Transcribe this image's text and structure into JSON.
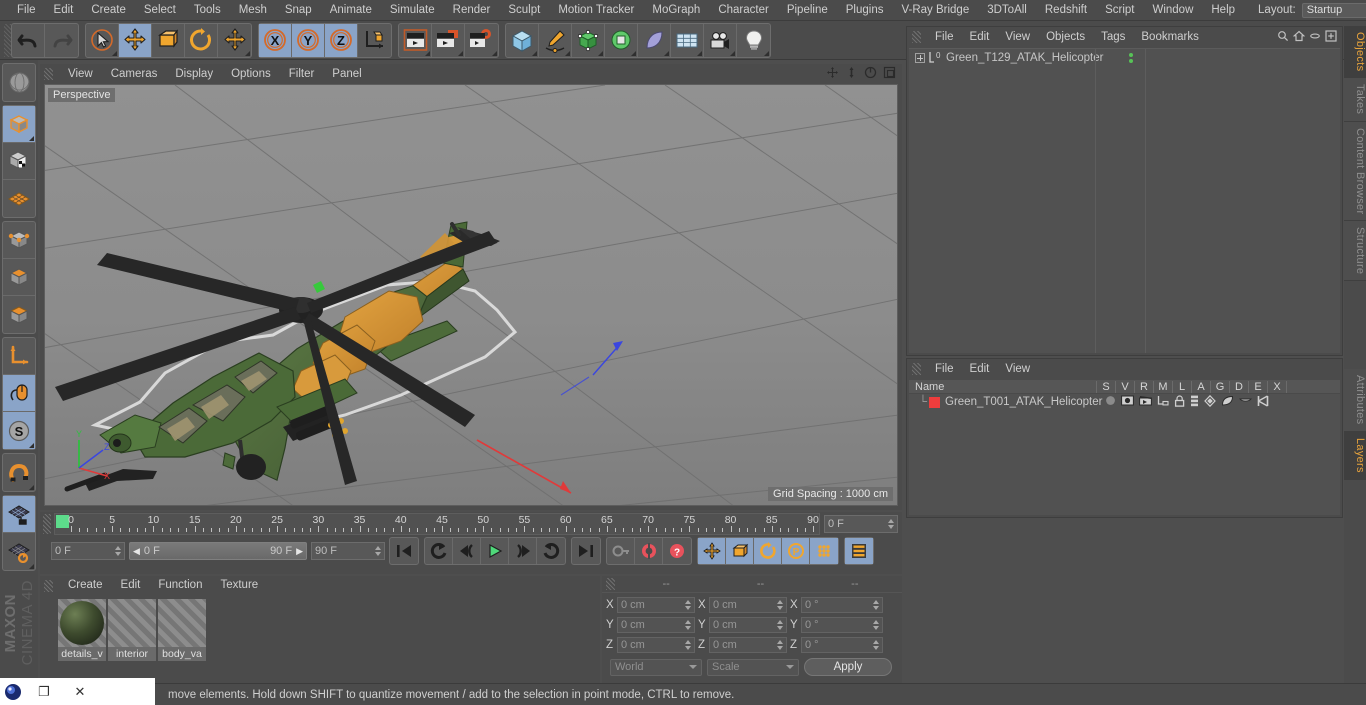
{
  "menubar": {
    "items": [
      "File",
      "Edit",
      "Create",
      "Select",
      "Tools",
      "Mesh",
      "Snap",
      "Animate",
      "Simulate",
      "Render",
      "Sculpt",
      "Motion Tracker",
      "MoGraph",
      "Character",
      "Pipeline",
      "Plugins",
      "V-Ray Bridge",
      "3DToAll",
      "Redshift",
      "Script",
      "Window",
      "Help"
    ],
    "layout_label": "Layout:",
    "layout_value": "Startup"
  },
  "viewport": {
    "menu_items": [
      "View",
      "Cameras",
      "Display",
      "Options",
      "Filter",
      "Panel"
    ],
    "label": "Perspective",
    "grid_spacing": "Grid Spacing : 1000 cm",
    "axis_x": "X",
    "axis_y": "Y",
    "axis_z": "Z"
  },
  "timeline": {
    "ticks": [
      "0",
      "5",
      "10",
      "15",
      "20",
      "25",
      "30",
      "35",
      "40",
      "45",
      "50",
      "55",
      "60",
      "65",
      "70",
      "75",
      "80",
      "85",
      "90"
    ],
    "current_frame": "0 F",
    "range_start": "0 F",
    "range_end": "90 F",
    "max_frame": "90 F",
    "end_field": "0 F"
  },
  "materials": {
    "menu_items": [
      "Create",
      "Edit",
      "Function",
      "Texture"
    ],
    "items": [
      {
        "name": "details_v",
        "selected": true
      },
      {
        "name": "interior",
        "selected": false
      },
      {
        "name": "body_va",
        "selected": false
      }
    ]
  },
  "coordinates": {
    "headers": [
      "--",
      "--",
      "--"
    ],
    "rows": [
      {
        "axis": "X",
        "position": "0 cm",
        "size": "0 cm",
        "rotation": "0 °"
      },
      {
        "axis": "Y",
        "position": "0 cm",
        "size": "0 cm",
        "rotation": "0 °"
      },
      {
        "axis": "Z",
        "position": "0 cm",
        "size": "0 cm",
        "rotation": "0 °"
      }
    ],
    "coord_system": "World",
    "mode": "Scale",
    "apply_label": "Apply"
  },
  "object_manager": {
    "menu_items": [
      "File",
      "Edit",
      "View",
      "Objects",
      "Tags",
      "Bookmarks"
    ],
    "object_name": "Green_T129_ATAK_Helicopter",
    "null_badge": "0",
    "tag_color": "#ee3d3d"
  },
  "layer_manager": {
    "menu_items": [
      "File",
      "Edit",
      "View"
    ],
    "columns": [
      "Name",
      "S",
      "V",
      "R",
      "M",
      "L",
      "A",
      "G",
      "D",
      "E",
      "X"
    ],
    "row_name": "Green_T001_ATAK_Helicopter",
    "row_color": "#ee3d3d"
  },
  "right_tabs": [
    {
      "label": "Objects",
      "active": true
    },
    {
      "label": "Takes",
      "active": false
    },
    {
      "label": "Content Browser",
      "active": false
    },
    {
      "label": "Structure",
      "active": false
    }
  ],
  "right_tabs_lower": [
    {
      "label": "Attributes",
      "active": false
    },
    {
      "label": "Layers",
      "active": true
    }
  ],
  "statusbar": {
    "text": "move elements. Hold down SHIFT to quantize movement / add to the selection in point mode, CTRL to remove."
  },
  "branding": {
    "maxon": "MAXON",
    "product": "CINEMA 4D"
  },
  "colors": {
    "accent_orange": "#e8a33c",
    "active_blue": "#8aa4c8",
    "panel_bg": "#4b4b4b",
    "viewport_bg": "#8a8a8a",
    "tag_red": "#ee3d3d",
    "heli_green": "#4f6b3c",
    "heli_tan": "#d99a3c"
  },
  "os_overlay": {
    "restore": "❐",
    "close": "✕"
  }
}
